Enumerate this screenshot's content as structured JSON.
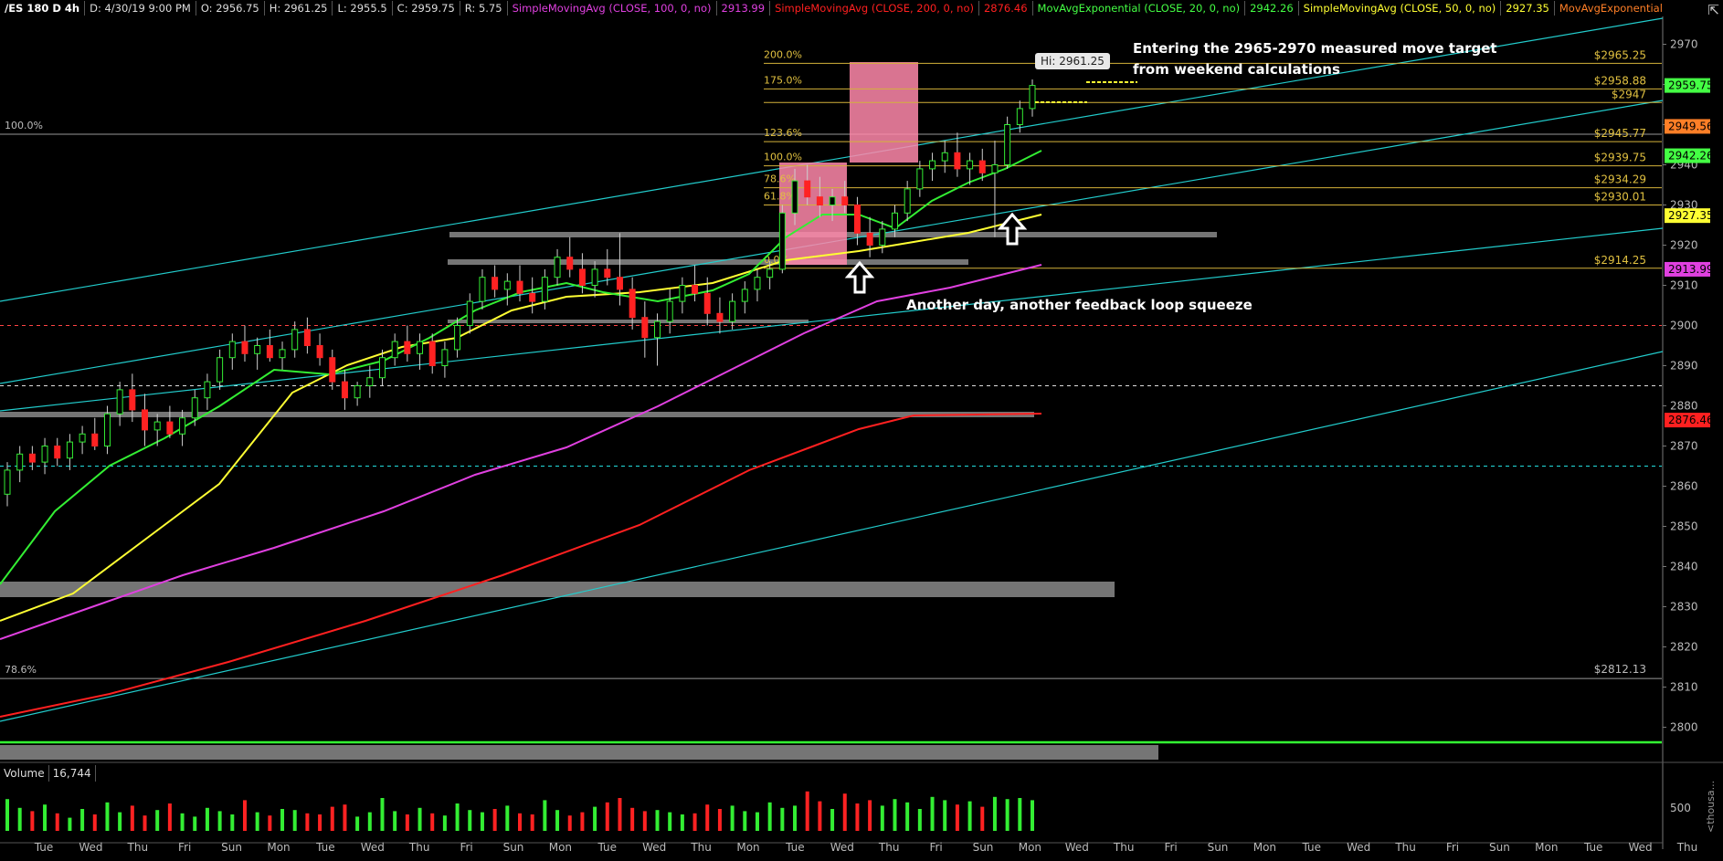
{
  "header": {
    "symbol": "/ES 180 D 4h",
    "date": "D: 4/30/19 9:00 PM",
    "open": "O: 2956.75",
    "high": "H: 2961.25",
    "low": "L: 2955.5",
    "close": "C: 2959.75",
    "range": "R: 5.75",
    "studies": [
      {
        "label": "SimpleMovingAvg (CLOSE, 100, 0, no)",
        "value": "2913.99",
        "color": "#e040e0"
      },
      {
        "label": "SimpleMovingAvg (CLOSE, 200, 0, no)",
        "value": "2876.46",
        "color": "#ff2020"
      },
      {
        "label": "MovAvgExponential (CLOSE, 20, 0, no)",
        "value": "2942.26",
        "color": "#44ff44"
      },
      {
        "label": "SimpleMovingAvg (CLOSE, 50, 0, no)",
        "value": "2927.35",
        "color": "#ffff33"
      },
      {
        "label": "MovAvgExponential ...",
        "value": "",
        "color": "#ff7f27"
      }
    ]
  },
  "volume_header": {
    "label": "Volume",
    "value": "16,744"
  },
  "annotations": {
    "target_line1": "Entering the 2965-2970 measured move target",
    "target_line2": "from weekend calculations",
    "squeeze": "Another day, another feedback loop squeeze",
    "hi_label": "Hi: 2961.25"
  },
  "chart_data": {
    "type": "candlestick",
    "price_axis": {
      "ylim": [
        2790,
        2975
      ],
      "ticks": [
        2970,
        2960,
        2950,
        2940,
        2930,
        2920,
        2910,
        2900,
        2890,
        2880,
        2870,
        2860,
        2850,
        2840,
        2830,
        2820,
        2810,
        2800
      ]
    },
    "x_ticks": [
      "Tue",
      "Wed",
      "Thu",
      "Fri",
      "Sun",
      "Mon",
      "Tue",
      "Wed",
      "Thu",
      "Fri",
      "Sun",
      "Mon",
      "Tue",
      "Wed",
      "Thu",
      "Mon",
      "Tue",
      "Wed",
      "Thu",
      "Fri",
      "Sun",
      "Mon",
      "Wed",
      "Thu",
      "Fri",
      "Sun",
      "Mon",
      "Tue",
      "Wed",
      "Thu",
      "Fri",
      "Sun",
      "Mon",
      "Tue",
      "Wed",
      "Thu"
    ],
    "badges": [
      {
        "value": "2959.75",
        "price": 2959.75,
        "color": "#44ff44"
      },
      {
        "value": "2949.56",
        "price": 2949.56,
        "color": "#ff7f27"
      },
      {
        "value": "2942.26",
        "price": 2942.26,
        "color": "#44ff44"
      },
      {
        "value": "2927.35",
        "price": 2927.35,
        "color": "#ffff33"
      },
      {
        "value": "2913.99",
        "price": 2913.99,
        "color": "#e040e0"
      },
      {
        "value": "2876.46",
        "price": 2876.46,
        "color": "#ff2020"
      }
    ],
    "fib_levels": [
      {
        "pct": "200.0%",
        "price_label": "$2965.25",
        "price": 2965.25
      },
      {
        "pct": "175.0%",
        "price_label": "$2958.88",
        "price": 2958.88
      },
      {
        "pct": "",
        "price_label": "$2947",
        "price": 2955.5
      },
      {
        "pct": "123.6%",
        "price_label": "$2945.77",
        "price": 2945.77
      },
      {
        "pct": "100.0%",
        "price_label": "$2939.75",
        "price": 2939.75
      },
      {
        "pct": "78.6%",
        "price_label": "$2934.29",
        "price": 2934.29
      },
      {
        "pct": "61.8%",
        "price_label": "$2930.01",
        "price": 2930.01
      },
      {
        "pct": "0.0%",
        "price_label": "$2914.25",
        "price": 2914.25
      }
    ],
    "big_fib": [
      {
        "pct": "100.0%",
        "price": 2947
      },
      {
        "pct": "78.6%",
        "price": 2812.13,
        "price_label": "$2812.13"
      }
    ],
    "volume_axis": {
      "tick": "500",
      "unit": "<thousa..."
    },
    "candles": [
      [
        2858,
        2866,
        2855,
        2864
      ],
      [
        2864,
        2870,
        2861,
        2868
      ],
      [
        2868,
        2870,
        2864,
        2866
      ],
      [
        2866,
        2872,
        2863,
        2870
      ],
      [
        2870,
        2872,
        2865,
        2867
      ],
      [
        2867,
        2873,
        2864,
        2871
      ],
      [
        2871,
        2875,
        2868,
        2873
      ],
      [
        2873,
        2877,
        2869,
        2870
      ],
      [
        2870,
        2880,
        2868,
        2878
      ],
      [
        2878,
        2886,
        2875,
        2884
      ],
      [
        2884,
        2888,
        2876,
        2879
      ],
      [
        2879,
        2883,
        2870,
        2874
      ],
      [
        2874,
        2878,
        2870,
        2876
      ],
      [
        2876,
        2880,
        2872,
        2873
      ],
      [
        2873,
        2879,
        2870,
        2877
      ],
      [
        2877,
        2884,
        2875,
        2882
      ],
      [
        2882,
        2888,
        2879,
        2886
      ],
      [
        2886,
        2894,
        2884,
        2892
      ],
      [
        2892,
        2898,
        2889,
        2896
      ],
      [
        2896,
        2900,
        2891,
        2893
      ],
      [
        2893,
        2897,
        2889,
        2895
      ],
      [
        2895,
        2899,
        2891,
        2892
      ],
      [
        2892,
        2896,
        2889,
        2894
      ],
      [
        2894,
        2901,
        2892,
        2899
      ],
      [
        2899,
        2902,
        2893,
        2895
      ],
      [
        2895,
        2898,
        2890,
        2892
      ],
      [
        2892,
        2894,
        2884,
        2886
      ],
      [
        2886,
        2889,
        2879,
        2882
      ],
      [
        2882,
        2886,
        2880,
        2885
      ],
      [
        2885,
        2890,
        2882,
        2887
      ],
      [
        2887,
        2894,
        2885,
        2892
      ],
      [
        2892,
        2898,
        2890,
        2896
      ],
      [
        2896,
        2900,
        2891,
        2893
      ],
      [
        2893,
        2898,
        2889,
        2896
      ],
      [
        2896,
        2898,
        2888,
        2890
      ],
      [
        2890,
        2896,
        2887,
        2894
      ],
      [
        2894,
        2902,
        2892,
        2900
      ],
      [
        2900,
        2908,
        2898,
        2906
      ],
      [
        2906,
        2914,
        2904,
        2912
      ],
      [
        2912,
        2915,
        2907,
        2909
      ],
      [
        2909,
        2913,
        2905,
        2911
      ],
      [
        2911,
        2915,
        2906,
        2908
      ],
      [
        2908,
        2912,
        2903,
        2906
      ],
      [
        2906,
        2914,
        2904,
        2912
      ],
      [
        2912,
        2919,
        2910,
        2917
      ],
      [
        2917,
        2922,
        2912,
        2914
      ],
      [
        2914,
        2918,
        2908,
        2910
      ],
      [
        2910,
        2916,
        2907,
        2914
      ],
      [
        2914,
        2919,
        2910,
        2912
      ],
      [
        2912,
        2923,
        2905,
        2909
      ],
      [
        2909,
        2912,
        2899,
        2902
      ],
      [
        2902,
        2906,
        2892,
        2897
      ],
      [
        2897,
        2903,
        2890,
        2901
      ],
      [
        2901,
        2909,
        2898,
        2906
      ],
      [
        2906,
        2912,
        2903,
        2910
      ],
      [
        2910,
        2915,
        2906,
        2908
      ],
      [
        2908,
        2912,
        2900,
        2903
      ],
      [
        2903,
        2907,
        2898,
        2901
      ],
      [
        2901,
        2908,
        2899,
        2906
      ],
      [
        2906,
        2911,
        2903,
        2909
      ],
      [
        2909,
        2914,
        2906,
        2912
      ],
      [
        2912,
        2916,
        2909,
        2914
      ],
      [
        2914,
        2930,
        2913,
        2928
      ],
      [
        2928,
        2939,
        2925,
        2936
      ],
      [
        2936,
        2940,
        2930,
        2932
      ],
      [
        2932,
        2937,
        2927,
        2930
      ],
      [
        2930,
        2934,
        2926,
        2932
      ],
      [
        2932,
        2936,
        2928,
        2930
      ],
      [
        2930,
        2932,
        2920,
        2923
      ],
      [
        2923,
        2927,
        2917,
        2920
      ],
      [
        2920,
        2926,
        2918,
        2924
      ],
      [
        2924,
        2930,
        2922,
        2928
      ],
      [
        2928,
        2936,
        2926,
        2934
      ],
      [
        2934,
        2941,
        2932,
        2939
      ],
      [
        2939,
        2943,
        2936,
        2941
      ],
      [
        2941,
        2946,
        2938,
        2943
      ],
      [
        2943,
        2948,
        2937,
        2939
      ],
      [
        2939,
        2943,
        2935,
        2941
      ],
      [
        2941,
        2944,
        2936,
        2938
      ],
      [
        2938,
        2946,
        2922,
        2940
      ],
      [
        2940,
        2952,
        2939,
        2950
      ],
      [
        2950,
        2956,
        2948,
        2954
      ],
      [
        2954,
        2961.25,
        2952,
        2959.75
      ]
    ],
    "volume": [
      290,
      210,
      180,
      240,
      160,
      120,
      200,
      150,
      260,
      170,
      230,
      140,
      190,
      250,
      160,
      130,
      210,
      180,
      150,
      280,
      170,
      140,
      200,
      190,
      160,
      150,
      220,
      240,
      130,
      170,
      300,
      180,
      150,
      210,
      160,
      140,
      250,
      190,
      170,
      200,
      230,
      160,
      150,
      280,
      190,
      140,
      170,
      220,
      260,
      300,
      210,
      180,
      190,
      170,
      150,
      160,
      240,
      200,
      230,
      180,
      170,
      260,
      210,
      230,
      360,
      270,
      200,
      340,
      250,
      280,
      230,
      290,
      260,
      200,
      310,
      280,
      240,
      270,
      220,
      310,
      290,
      300,
      280
    ]
  }
}
